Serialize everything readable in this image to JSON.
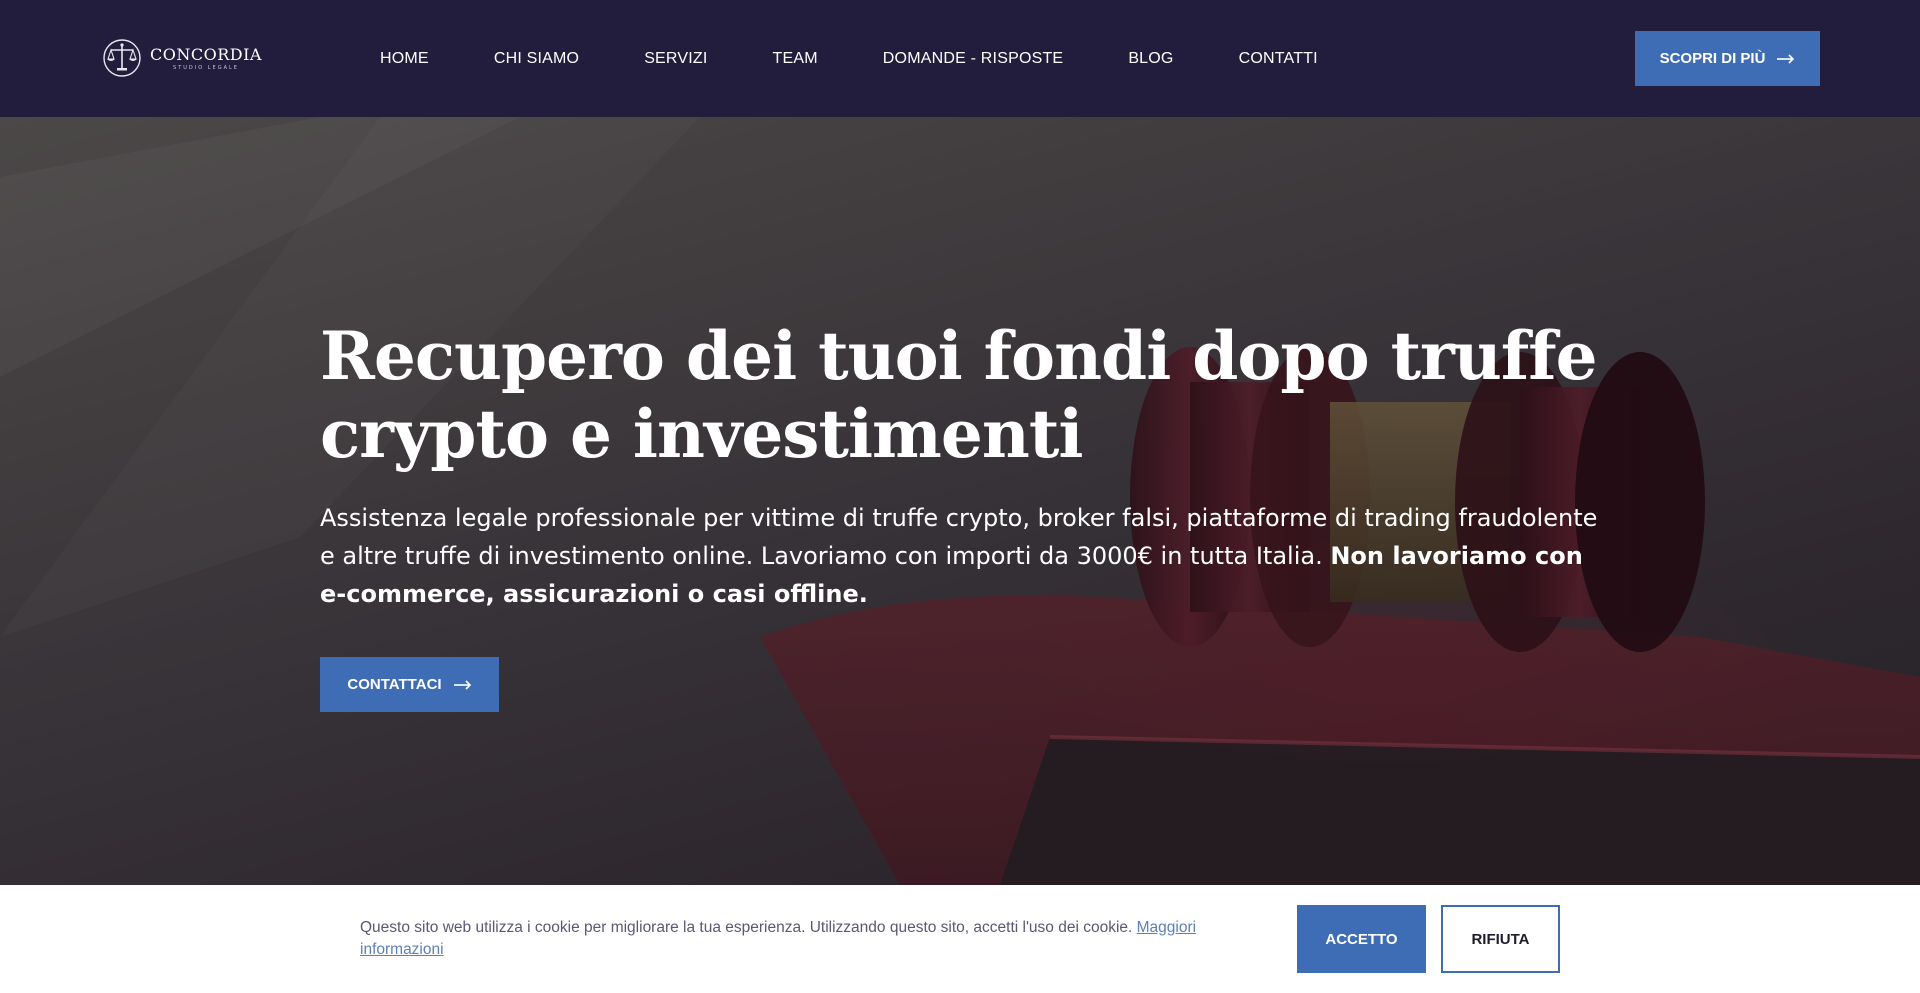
{
  "header": {
    "logo": {
      "name": "CONCORDIA",
      "subtitle": "STUDIO LEGALE",
      "icon": "scales-of-justice-icon"
    },
    "nav": [
      {
        "label": "HOME"
      },
      {
        "label": "CHI SIAMO"
      },
      {
        "label": "SERVIZI"
      },
      {
        "label": "TEAM"
      },
      {
        "label": "DOMANDE - RISPOSTE"
      },
      {
        "label": "BLOG"
      },
      {
        "label": "CONTATTI"
      }
    ],
    "cta_label": "SCOPRI DI PIÙ",
    "cta_icon": "arrow-right-icon"
  },
  "hero": {
    "title": "Recupero dei tuoi fondi dopo truffe crypto e investimenti",
    "text": "Assistenza legale professionale per vittime di truffe crypto, broker falsi, piattaforme di trading fraudolente e altre truffe di investimento online. Lavoriamo con importi da 3000€ in tutta Italia.",
    "text_bold": "Non lavoriamo con e-commerce, assicurazioni o casi offline.",
    "cta_label": "CONTATTACI",
    "cta_icon": "arrow-right-icon"
  },
  "cookie": {
    "text": "Questo sito web utilizza i cookie per migliorare la tua esperienza. Utilizzando questo sito, accetti l'uso dei cookie.",
    "link_label": "Maggiori informazioni",
    "accept_label": "ACCETTO",
    "reject_label": "RIFIUTA"
  },
  "colors": {
    "header_bg": "#231d3d",
    "accent": "#3f6db5",
    "cookie_text": "#5b5872",
    "link": "#5b7fb8"
  }
}
